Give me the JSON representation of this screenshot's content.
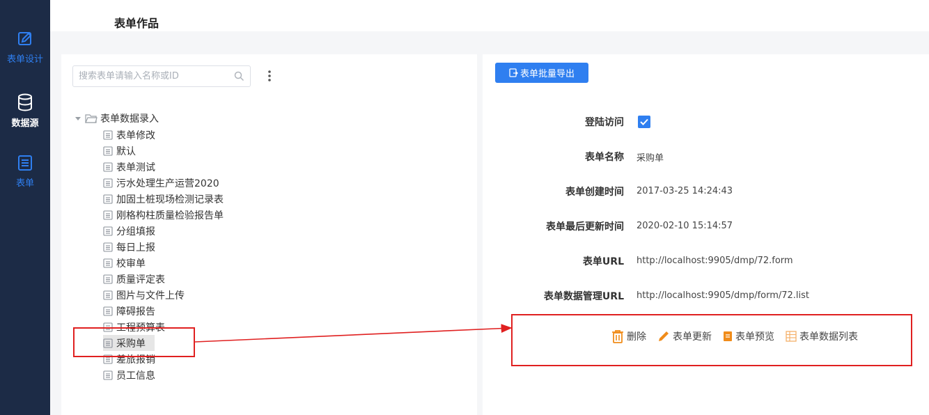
{
  "sidebar": {
    "items": [
      {
        "label": "表单设计",
        "icon": "edit-icon"
      },
      {
        "label": "数据源",
        "icon": "database-icon"
      },
      {
        "label": "表单",
        "icon": "form-icon"
      }
    ]
  },
  "header": {
    "title": "表单作品"
  },
  "search": {
    "placeholder": "搜索表单请输入名称或ID"
  },
  "tree": {
    "root": "表单数据录入",
    "items": [
      "表单修改",
      "默认",
      "表单测试",
      "污水处理生产运营2020",
      "加固土桩现场检测记录表",
      "刚格构柱质量检验报告单",
      "分组填报",
      "每日上报",
      "校审单",
      "质量评定表",
      "图片与文件上传",
      "障碍报告",
      "工程预算表",
      "采购单",
      "差旅报销",
      "员工信息"
    ],
    "selected_index": 13
  },
  "detail": {
    "export_label": "表单批量导出",
    "fields": {
      "login_label": "登陆访问",
      "name_label": "表单名称",
      "name_value": "采购单",
      "created_label": "表单创建时间",
      "created_value": "2017-03-25 14:24:43",
      "updated_label": "表单最后更新时间",
      "updated_value": "2020-02-10 15:14:57",
      "url_label": "表单URL",
      "url_value": "http://localhost:9905/dmp/72.form",
      "data_url_label": "表单数据管理URL",
      "data_url_value": "http://localhost:9905/dmp/form/72.list"
    },
    "login_checked": true,
    "actions": {
      "delete": "删除",
      "update": "表单更新",
      "preview": "表单预览",
      "data_list": "表单数据列表"
    }
  },
  "colors": {
    "sidebar_bg": "#1c2b46",
    "accent": "#2f7ff0",
    "action_orange": "#f08c1a",
    "annotation_red": "#e02020"
  }
}
